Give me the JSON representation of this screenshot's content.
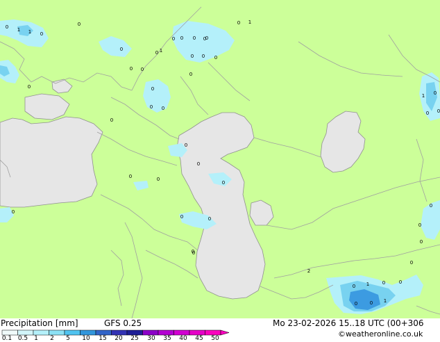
{
  "header": {
    "title": "Precipitation [mm]",
    "model": "GFS 0.25",
    "valid_time": "Mo 23-02-2026 15..18 UTC (00+306",
    "credit": "©weatheronline.co.uk"
  },
  "colors": {
    "land": "#ccff99",
    "water": "#e6e6e6",
    "border": "#a0a0a0",
    "coast": "#909090",
    "precip_light": "#b4f0fa",
    "precip_med": "#78d2f0",
    "precip_heavy": "#3c9be1"
  },
  "legend": {
    "labels": [
      "0.1",
      "0.5",
      "1",
      "2",
      "5",
      "10",
      "15",
      "20",
      "25",
      "30",
      "35",
      "40",
      "45",
      "50"
    ],
    "colors": [
      "#f0fafa",
      "#d2f5fa",
      "#b4f0fa",
      "#8ce1f5",
      "#50c3f0",
      "#3296dc",
      "#3264c8",
      "#3232b4",
      "#1e1e96",
      "#8c00c8",
      "#b400d2",
      "#d200d2",
      "#e600c8",
      "#fa00be"
    ]
  },
  "precip_labels": [
    {
      "text": "0"
    },
    {
      "text": "1"
    },
    {
      "text": "1"
    },
    {
      "text": "0"
    },
    {
      "text": "0"
    },
    {
      "text": "0"
    },
    {
      "text": "0"
    },
    {
      "text": "0"
    },
    {
      "text": "0"
    },
    {
      "text": "0"
    },
    {
      "text": "0"
    },
    {
      "text": "0"
    },
    {
      "text": "0"
    },
    {
      "text": "0"
    },
    {
      "text": "1"
    },
    {
      "text": "0"
    },
    {
      "text": "0"
    },
    {
      "text": "0"
    },
    {
      "text": "0"
    },
    {
      "text": "0"
    },
    {
      "text": "0"
    },
    {
      "text": "0"
    },
    {
      "text": "0"
    },
    {
      "text": "0"
    },
    {
      "text": "0"
    },
    {
      "text": "0"
    },
    {
      "text": "0"
    },
    {
      "text": "0"
    },
    {
      "text": "0"
    },
    {
      "text": "0"
    },
    {
      "text": "0"
    },
    {
      "text": "0"
    },
    {
      "text": "0"
    },
    {
      "text": "1"
    },
    {
      "text": "0"
    },
    {
      "text": "0"
    },
    {
      "text": "0"
    },
    {
      "text": "0"
    },
    {
      "text": "0"
    },
    {
      "text": "0"
    },
    {
      "text": "0"
    },
    {
      "text": "0"
    },
    {
      "text": "0"
    },
    {
      "text": "1"
    },
    {
      "text": "0"
    },
    {
      "text": "0"
    },
    {
      "text": "0"
    },
    {
      "text": "1"
    },
    {
      "text": "2"
    },
    {
      "text": "0"
    },
    {
      "text": "1"
    },
    {
      "text": "0"
    }
  ]
}
